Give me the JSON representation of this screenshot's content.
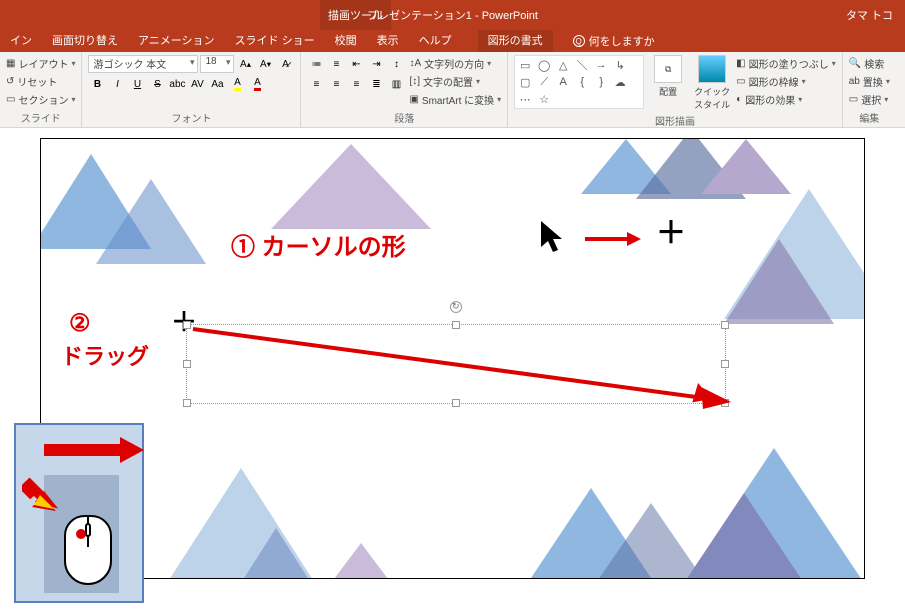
{
  "titlebar": {
    "drawing_tools": "描画ツール",
    "title": "プレゼンテーション1 - PowerPoint",
    "user": "タマ トコ"
  },
  "tabs": {
    "design": "イン",
    "transitions": "画面切り替え",
    "animations": "アニメーション",
    "slideshow": "スライド ショー",
    "review": "校閲",
    "view": "表示",
    "help": "ヘルプ",
    "format": "図形の書式",
    "tellme": "何をしますか"
  },
  "ribbon": {
    "slide": {
      "layout": "レイアウト",
      "reset": "リセット",
      "section": "セクション",
      "label": "スライド"
    },
    "font": {
      "name": "游ゴシック 本文",
      "size": "18",
      "bold": "B",
      "italic": "I",
      "underline": "U",
      "strike": "S",
      "shadow": "abc",
      "spacing": "AV",
      "clearfmt": "Aa",
      "label": "フォント"
    },
    "paragraph": {
      "textdir": "文字列の方向",
      "align": "文字の配置",
      "smartart": "SmartArt に変換",
      "label": "段落"
    },
    "drawing": {
      "arrange": "配置",
      "quickstyles": "クイック\nスタイル",
      "fill": "図形の塗りつぶし",
      "outline": "図形の枠線",
      "effects": "図形の効果",
      "label": "図形描画"
    },
    "editing": {
      "find": "検索",
      "replace": "置換",
      "select": "選択",
      "label": "編集"
    }
  },
  "annotations": {
    "step1_num": "①",
    "step1_text": "カーソルの形",
    "step2_num": "②",
    "step2_text": "ドラッグ"
  }
}
